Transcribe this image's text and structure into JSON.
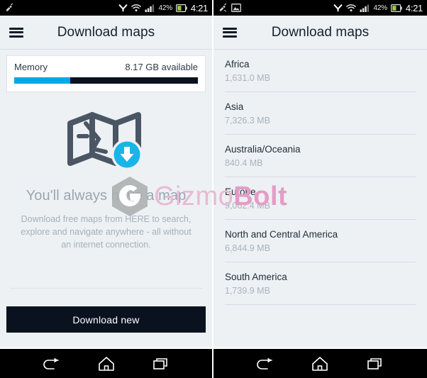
{
  "status_bar": {
    "left_icons_screen1": [
      "gps-icon"
    ],
    "left_icons_screen2": [
      "gps-icon",
      "image-icon"
    ],
    "right_icons": [
      "bluetooth-icon",
      "wifi-icon",
      "signal-icon",
      "battery-icon"
    ],
    "battery_percent": "42%",
    "time": "4:21"
  },
  "screen1": {
    "appbar": {
      "menu_icon": "hamburger-icon",
      "title": "Download maps"
    },
    "memory": {
      "label": "Memory",
      "available": "8.17 GB available",
      "used_fraction": 0.305,
      "fill_color": "#00a8e8",
      "track_color": "#0a1220"
    },
    "hero": {
      "illustration": "folded-map-with-download-badge",
      "title": "You'll always have a map",
      "description": "Download free maps from HERE to search, explore and navigate anywhere - all without an internet connection."
    },
    "download_button": {
      "label": "Download new",
      "background": "#0a1220",
      "text_color": "#ffffff"
    }
  },
  "screen2": {
    "appbar": {
      "menu_icon": "hamburger-icon",
      "title": "Download maps"
    },
    "regions": [
      {
        "name": "Africa",
        "size": "1,631.0 MB"
      },
      {
        "name": "Asia",
        "size": "7,326.3 MB"
      },
      {
        "name": "Australia/Oceania",
        "size": "840.4 MB"
      },
      {
        "name": "Europe",
        "size": "9,062.4 MB"
      },
      {
        "name": "North and Central America",
        "size": "6,844.9 MB"
      },
      {
        "name": "South America",
        "size": "1,739.9 MB"
      }
    ]
  },
  "navigation_bar": {
    "buttons": [
      {
        "icon": "back-icon"
      },
      {
        "icon": "home-icon"
      },
      {
        "icon": "recents-icon"
      }
    ]
  },
  "watermark": {
    "logo": "gizmobolt-hexagon-g-logo",
    "text_light": "Gizmo",
    "text_bold": "Bolt",
    "color_light": "#e9b9d4",
    "color_bold": "#e49cc6"
  }
}
